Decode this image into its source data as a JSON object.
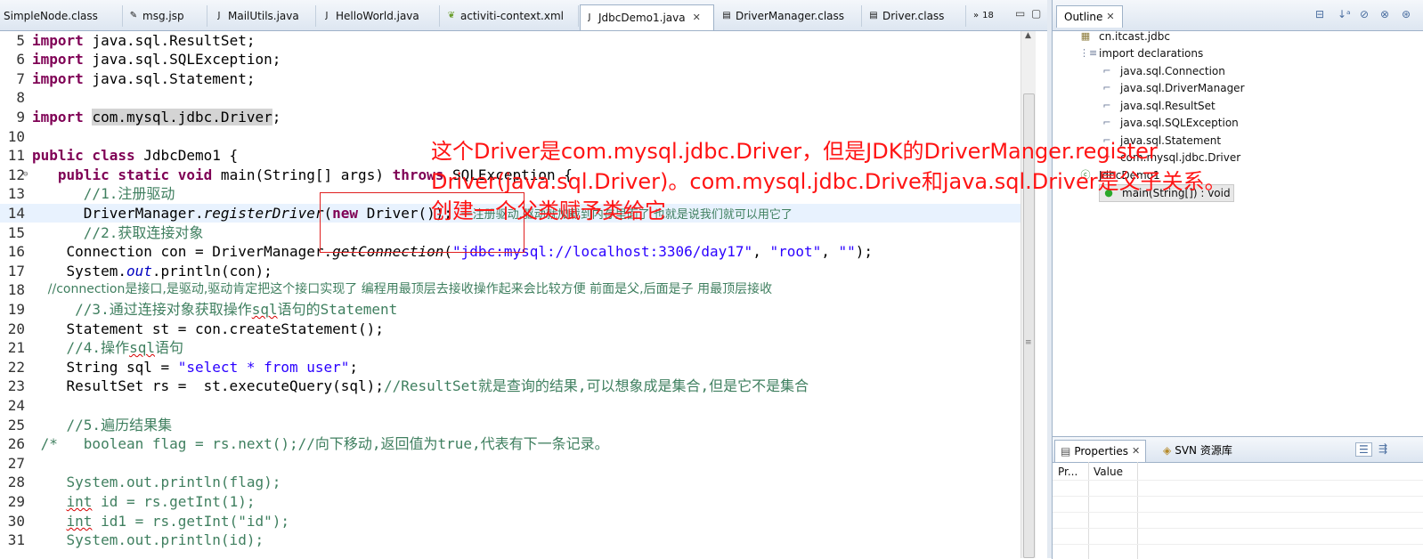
{
  "tabs": [
    {
      "label": "SimpleNode.class",
      "icon": "class-file-icon"
    },
    {
      "label": "msg.jsp",
      "icon": "jsp-file-icon"
    },
    {
      "label": "MailUtils.java",
      "icon": "java-file-icon"
    },
    {
      "label": "HelloWorld.java",
      "icon": "java-file-icon"
    },
    {
      "label": "activiti-context.xml",
      "icon": "xml-file-icon"
    },
    {
      "label": "JdbcDemo1.java",
      "icon": "java-file-icon",
      "active": true
    },
    {
      "label": "DriverManager.class",
      "icon": "class-file-icon"
    },
    {
      "label": "Driver.class",
      "icon": "class-file-icon"
    }
  ],
  "tab_overflow": "18",
  "editor": {
    "lines": [
      {
        "n": "5",
        "code": "import java.sql.ResultSet;"
      },
      {
        "n": "6",
        "code": "import java.sql.SQLException;"
      },
      {
        "n": "7",
        "code": "import java.sql.Statement;"
      },
      {
        "n": "8",
        "code": ""
      },
      {
        "n": "9",
        "code": "import com.mysql.jdbc.Driver;"
      },
      {
        "n": "10",
        "code": ""
      },
      {
        "n": "11",
        "code": "public class JdbcDemo1 {"
      },
      {
        "n": "12",
        "code": "   public static void main(String[] args) throws SQLException {"
      },
      {
        "n": "13",
        "code": "      //1.注册驱动"
      },
      {
        "n": "14",
        "code": "      DriverManager.registerDriver(new Driver()); 一注册驱动,驱动就加载到内存里面了 也就是说我们就可以用它了"
      },
      {
        "n": "15",
        "code": "      //2.获取连接对象"
      },
      {
        "n": "16",
        "code": "    Connection con = DriverManager.getConnection(\"jdbc:mysql://localhost:3306/day17\", \"root\", \"\");"
      },
      {
        "n": "17",
        "code": "    System.out.println(con);"
      },
      {
        "n": "18",
        "code": "    //connection是接口,是驱动,驱动肯定把这个接口实现了 编程用最顶层去接收操作起来会比较方便 前面是父,后面是子 用最顶层接收"
      },
      {
        "n": "19",
        "code": "     //3.通过连接对象获取操作sql语句的Statement"
      },
      {
        "n": "20",
        "code": "    Statement st = con.createStatement();"
      },
      {
        "n": "21",
        "code": "    //4.操作sql语句"
      },
      {
        "n": "22",
        "code": "    String sql = \"select * from user\";"
      },
      {
        "n": "23",
        "code": "    ResultSet rs =  st.executeQuery(sql);//ResultSet就是查询的结果,可以想象成是集合,但是它不是集合"
      },
      {
        "n": "24",
        "code": ""
      },
      {
        "n": "25",
        "code": "    //5.遍历结果集"
      },
      {
        "n": "26",
        "code": " /*   boolean flag = rs.next();//向下移动,返回值为true,代表有下一条记录。"
      },
      {
        "n": "27",
        "code": ""
      },
      {
        "n": "28",
        "code": "    System.out.println(flag);"
      },
      {
        "n": "29",
        "code": "    int id = rs.getInt(1);"
      },
      {
        "n": "30",
        "code": "    int id1 = rs.getInt(\"id\");"
      },
      {
        "n": "31",
        "code": "    System.out.println(id);"
      }
    ]
  },
  "annotation": {
    "line1": "这个Driver是com.mysql.jdbc.Driver，但是JDK的DriverManger.register",
    "line2": "Driver(java.sql.Driver)。com.mysql.jdbc.Drive和java.sql.Driver是父子关系。",
    "line3": "创建一个父类赋予类给它",
    "color": "#ff1414"
  },
  "outline": {
    "title": "Outline",
    "items": [
      {
        "label": "cn.itcast.jdbc",
        "icon": "package-icon"
      },
      {
        "label": "import declarations",
        "icon": "imports-icon"
      },
      {
        "label": "java.sql.Connection",
        "icon": "import-icon"
      },
      {
        "label": "java.sql.DriverManager",
        "icon": "import-icon"
      },
      {
        "label": "java.sql.ResultSet",
        "icon": "import-icon"
      },
      {
        "label": "java.sql.SQLException",
        "icon": "import-icon"
      },
      {
        "label": "java.sql.Statement",
        "icon": "import-icon"
      },
      {
        "label": "com.mysql.jdbc.Driver",
        "icon": "import-icon"
      },
      {
        "label": "JdbcDemo1",
        "icon": "class-icon"
      },
      {
        "label": "main(String[]) : void",
        "icon": "method-icon"
      }
    ]
  },
  "properties": {
    "tab": "Properties",
    "svn_tab": "SVN 资源库",
    "col_property": "Pr...",
    "col_value": "Value"
  }
}
